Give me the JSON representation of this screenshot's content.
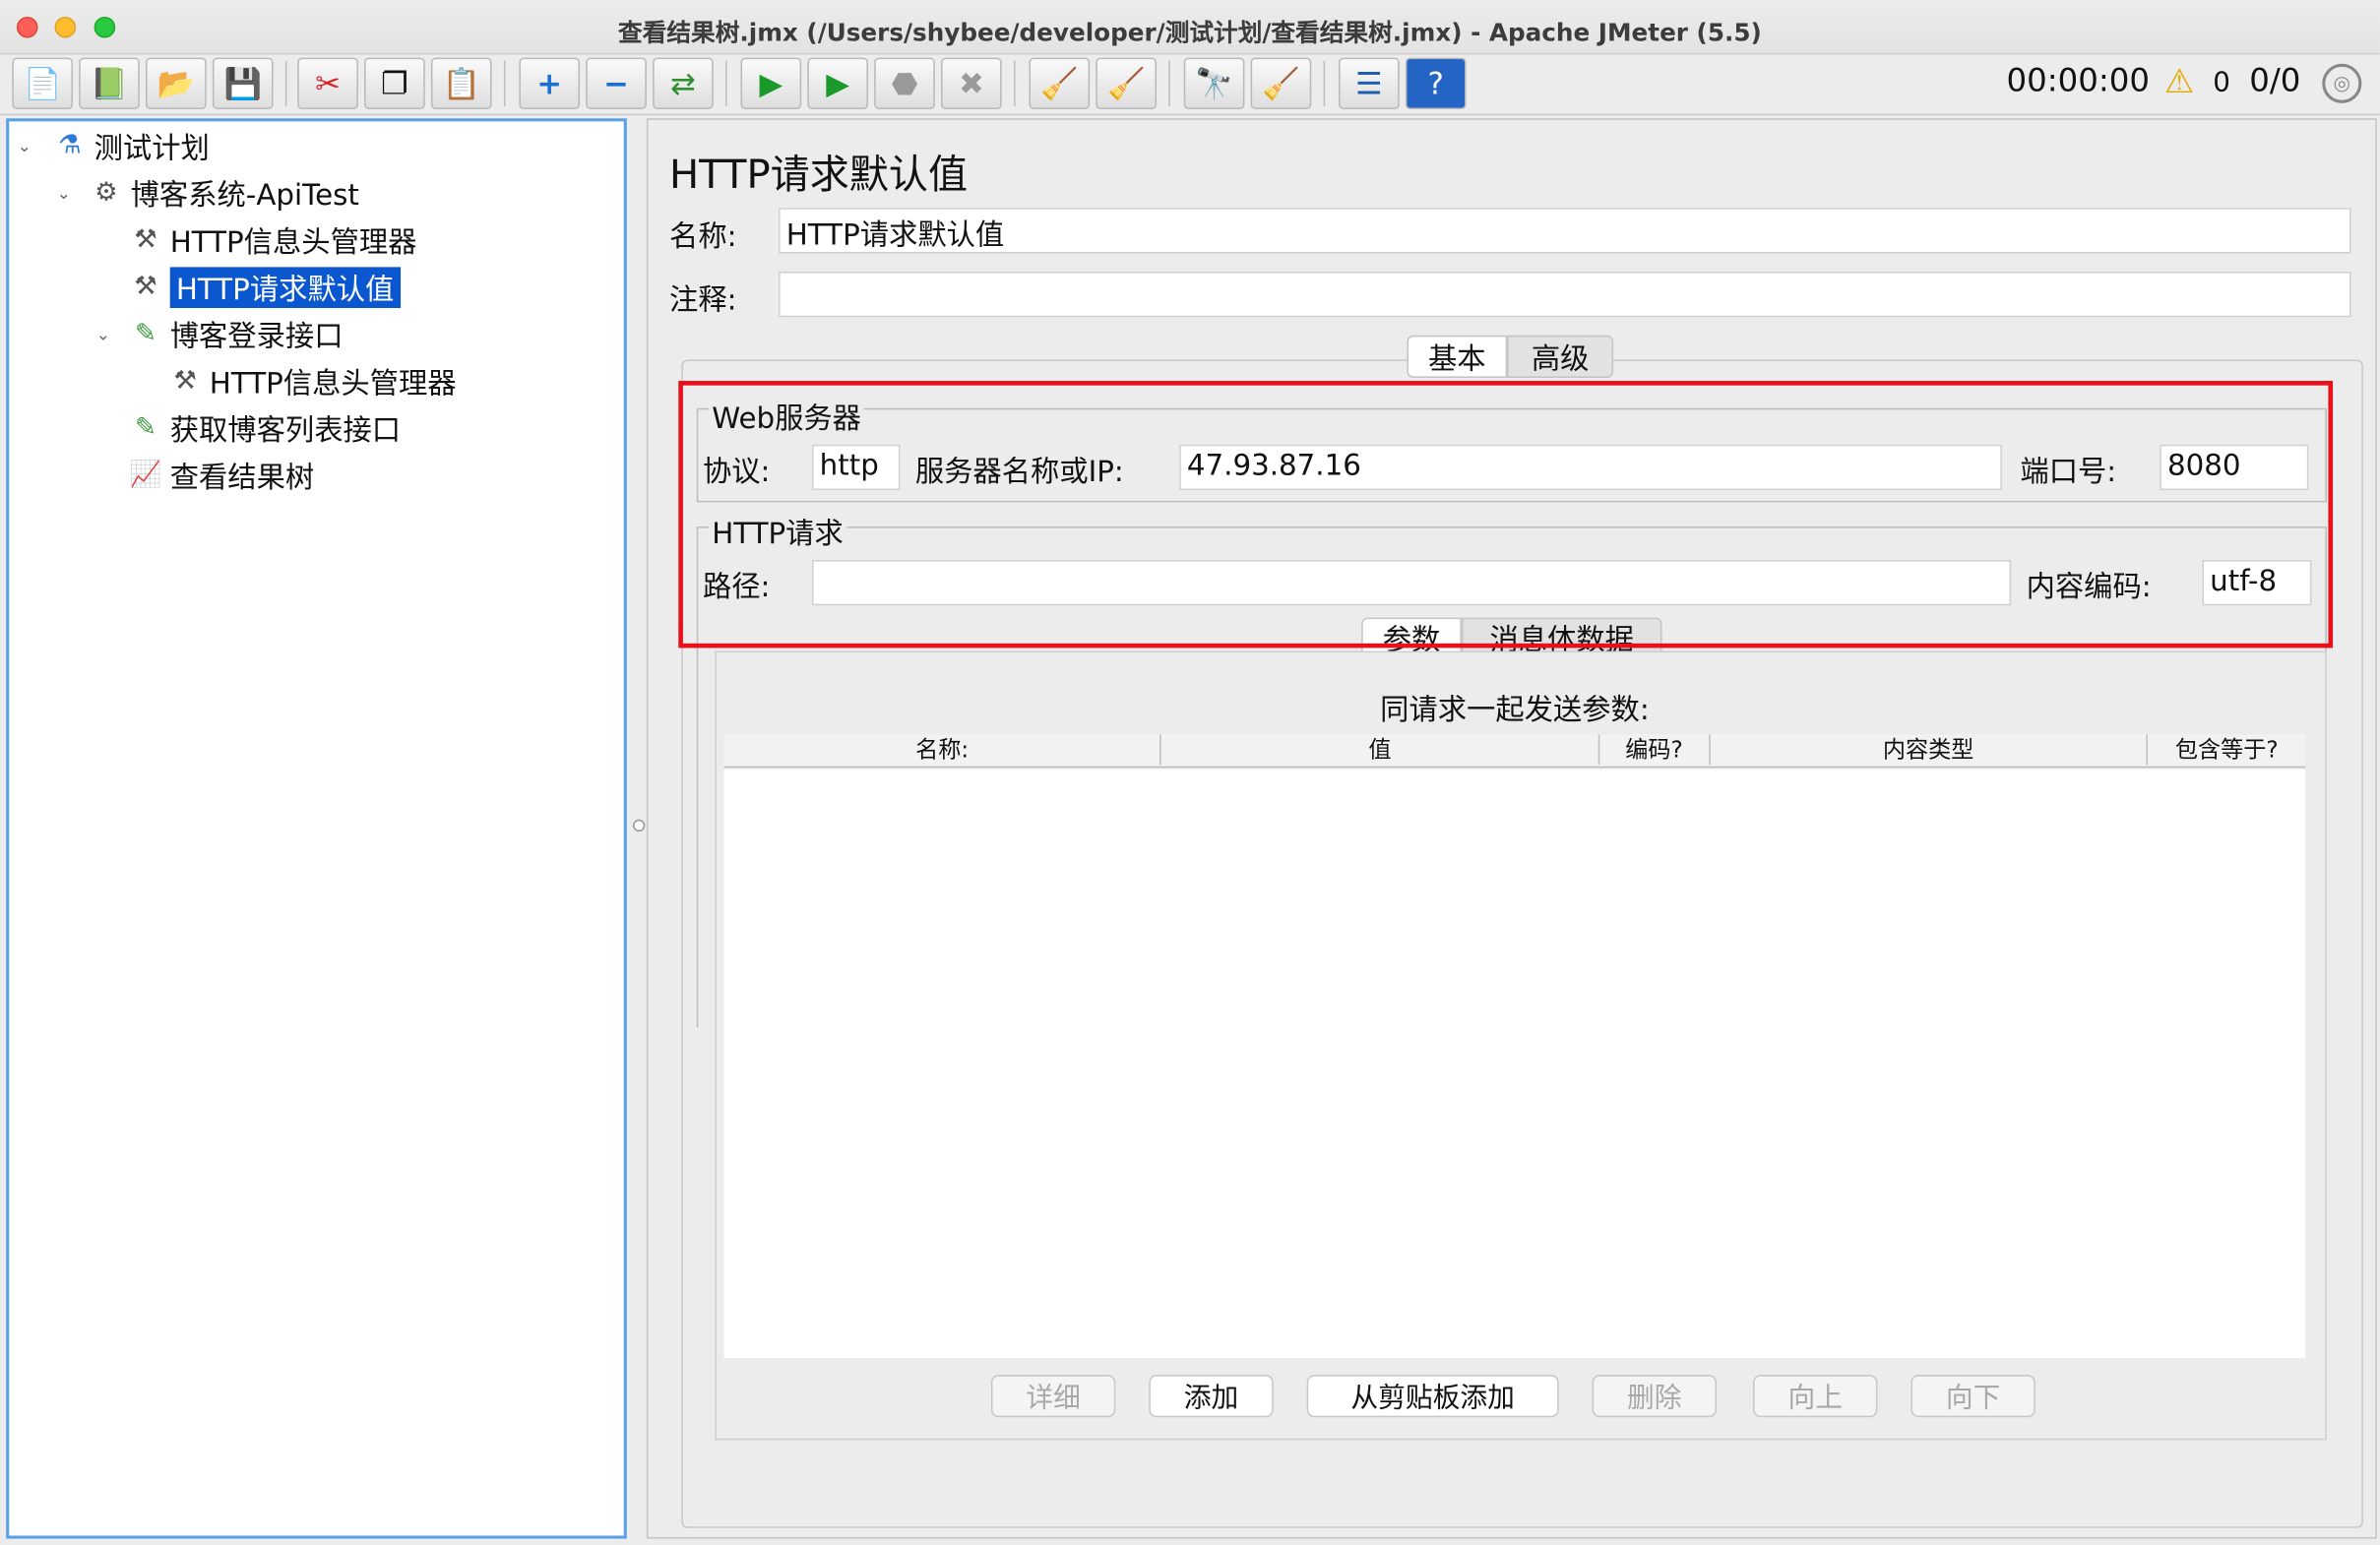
{
  "window": {
    "title": "查看结果树.jmx (/Users/shybee/developer/测试计划/查看结果树.jmx) - Apache JMeter (5.5)"
  },
  "toolbar": {
    "timer": "00:00:00",
    "warning_count": "0",
    "threads": "0/0",
    "buttons": [
      "new-icon",
      "templates-icon",
      "open-icon",
      "save-icon",
      "cut-icon",
      "copy-icon",
      "paste-icon",
      "expand-icon",
      "collapse-icon",
      "toggle-icon",
      "start-icon",
      "start-no-pause-icon",
      "stop-icon",
      "shutdown-icon",
      "clear-icon",
      "clear-all-icon",
      "search-icon",
      "reset-search-icon",
      "function-helper-icon",
      "help-icon"
    ]
  },
  "tree": {
    "items": [
      {
        "label": "测试计划"
      },
      {
        "label": "博客系统-ApiTest"
      },
      {
        "label": "HTTP信息头管理器"
      },
      {
        "label": "HTTP请求默认值"
      },
      {
        "label": "博客登录接口"
      },
      {
        "label": "HTTP信息头管理器"
      },
      {
        "label": "获取博客列表接口"
      },
      {
        "label": "查看结果树"
      }
    ]
  },
  "panel": {
    "title": "HTTP请求默认值",
    "name_label": "名称:",
    "name_value": "HTTP请求默认值",
    "comment_label": "注释:",
    "comment_value": "",
    "tabs": [
      "基本",
      "高级"
    ],
    "web_server": {
      "group_title": "Web服务器",
      "protocol_label": "协议:",
      "protocol_value": "http",
      "server_label": "服务器名称或IP:",
      "server_value": "47.93.87.16",
      "port_label": "端口号:",
      "port_value": "8080"
    },
    "http_request": {
      "group_title": "HTTP请求",
      "path_label": "路径:",
      "path_value": "",
      "encoding_label": "内容编码:",
      "encoding_value": "utf-8"
    },
    "sub_tabs": [
      "参数",
      "消息体数据"
    ],
    "params_title": "同请求一起发送参数:",
    "columns": [
      "名称:",
      "值",
      "编码?",
      "内容类型",
      "包含等于?"
    ],
    "buttons": {
      "detail": "详细",
      "add": "添加",
      "add_clipboard": "从剪贴板添加",
      "delete": "删除",
      "up": "向上",
      "down": "向下"
    }
  },
  "colors": {
    "selection": "#0b57d0",
    "highlight_box": "#e8101a",
    "tree_border": "#5aa0e4"
  }
}
